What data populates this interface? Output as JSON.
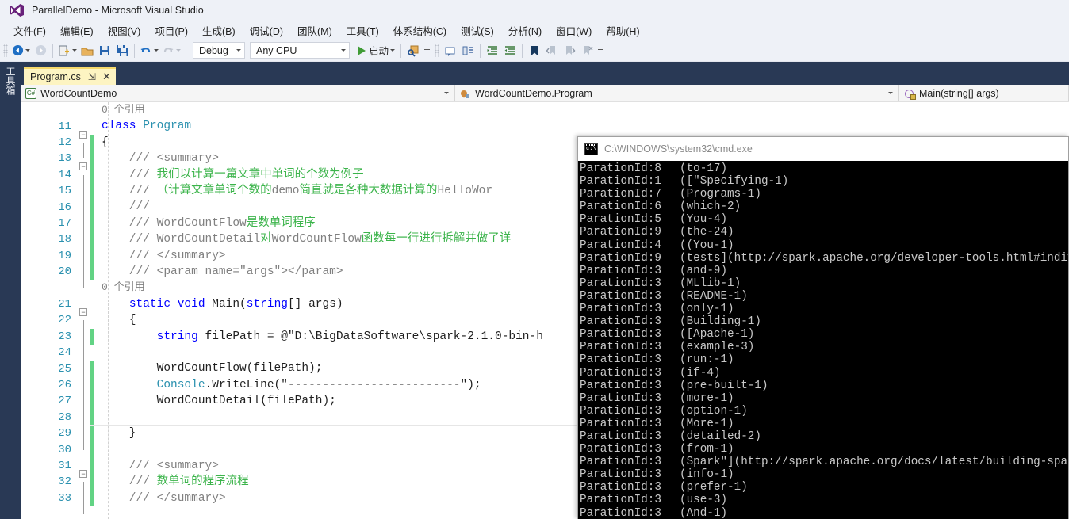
{
  "window": {
    "title": "ParallelDemo - Microsoft Visual Studio",
    "logo_icon": "visual-studio-logo"
  },
  "menubar": {
    "items": [
      {
        "label": "文件(F)"
      },
      {
        "label": "编辑(E)"
      },
      {
        "label": "视图(V)"
      },
      {
        "label": "项目(P)"
      },
      {
        "label": "生成(B)"
      },
      {
        "label": "调试(D)"
      },
      {
        "label": "团队(M)"
      },
      {
        "label": "工具(T)"
      },
      {
        "label": "体系结构(C)"
      },
      {
        "label": "测试(S)"
      },
      {
        "label": "分析(N)"
      },
      {
        "label": "窗口(W)"
      },
      {
        "label": "帮助(H)"
      }
    ]
  },
  "toolbar": {
    "back_icon": "navigate-back-icon",
    "forward_icon": "navigate-forward-icon",
    "new_item_icon": "new-item-icon",
    "open_icon": "open-file-icon",
    "save_icon": "save-icon",
    "save_all_icon": "save-all-icon",
    "undo_icon": "undo-icon",
    "redo_icon": "redo-icon",
    "configuration": "Debug",
    "platform": "Any CPU",
    "start_label": "启动",
    "start_icon": "play-icon",
    "find_icon": "find-in-files-icon",
    "comment_icon": "comment-selection-icon",
    "uncomment_icon": "uncomment-selection-icon",
    "indent_icon": "increase-indent-icon",
    "outdent_icon": "decrease-indent-icon",
    "bookmark_icon": "bookmark-icon",
    "prev_bookmark_icon": "previous-bookmark-icon",
    "next_bookmark_icon": "next-bookmark-icon",
    "clear_bookmark_icon": "clear-bookmarks-icon",
    "overflow_icon": "toolbar-overflow-icon"
  },
  "toolbox": {
    "label": "工具箱"
  },
  "tab": {
    "title": "Program.cs",
    "pin_icon": "pin-icon",
    "close_icon": "close-icon"
  },
  "navbar": {
    "project": "WordCountDemo",
    "project_icon": "csharp-project-icon",
    "type": "WordCountDemo.Program",
    "type_icon": "class-icon",
    "member": "Main(string[] args)",
    "member_icon": "method-icon"
  },
  "editor": {
    "ref_label_class": "0 个引用",
    "ref_label_main": "0 个引用",
    "lines": [
      {
        "num": "11",
        "text": "class Program",
        "change": "none",
        "fold": "minus"
      },
      {
        "num": "12",
        "text": "{",
        "change": "green",
        "fold": "none"
      },
      {
        "num": "13",
        "text": "    /// <summary>",
        "change": "green",
        "fold": "minus"
      },
      {
        "num": "14",
        "text": "    /// 我们以计算一篇文章中单词的个数为例子",
        "change": "green",
        "fold": "none"
      },
      {
        "num": "15",
        "text": "    /// （计算文章单词个数的demo简直就是各种大数据计算的HelloWor",
        "change": "green",
        "fold": "none"
      },
      {
        "num": "16",
        "text": "    ///",
        "change": "green",
        "fold": "none"
      },
      {
        "num": "17",
        "text": "    /// WordCountFlow是数单词程序",
        "change": "green",
        "fold": "none"
      },
      {
        "num": "18",
        "text": "    /// WordCountDetail对WordCountFlow函数每一行进行拆解并做了详",
        "change": "green",
        "fold": "none"
      },
      {
        "num": "19",
        "text": "    /// </summary>",
        "change": "green",
        "fold": "none"
      },
      {
        "num": "20",
        "text": "    /// <param name=\"args\"></param>",
        "change": "green",
        "fold": "none"
      },
      {
        "num": "21",
        "text": "    static void Main(string[] args)",
        "change": "none",
        "fold": "minus"
      },
      {
        "num": "22",
        "text": "    {",
        "change": "none",
        "fold": "none"
      },
      {
        "num": "23",
        "text": "        string filePath = @\"D:\\BigDataSoftware\\spark-2.1.0-bin-h",
        "change": "green",
        "fold": "none"
      },
      {
        "num": "24",
        "text": "",
        "change": "none",
        "fold": "none"
      },
      {
        "num": "25",
        "text": "        WordCountFlow(filePath);",
        "change": "green",
        "fold": "none"
      },
      {
        "num": "26",
        "text": "        Console.WriteLine(\"-------------------------\");",
        "change": "green",
        "fold": "none"
      },
      {
        "num": "27",
        "text": "        WordCountDetail(filePath);",
        "change": "green",
        "fold": "none"
      },
      {
        "num": "28",
        "text": "",
        "change": "green",
        "fold": "none"
      },
      {
        "num": "29",
        "text": "    }",
        "change": "green",
        "fold": "none"
      },
      {
        "num": "30",
        "text": "",
        "change": "green",
        "fold": "none"
      },
      {
        "num": "31",
        "text": "    /// <summary>",
        "change": "green",
        "fold": "minus"
      },
      {
        "num": "32",
        "text": "    /// 数单词的程序流程",
        "change": "green",
        "fold": "none"
      },
      {
        "num": "33",
        "text": "    /// </summary>",
        "change": "green",
        "fold": "none"
      }
    ]
  },
  "console": {
    "title": "C:\\WINDOWS\\system32\\cmd.exe",
    "icon": "cmd-icon",
    "rows": [
      {
        "pid": "ParationId:8",
        "value": "(to-17)"
      },
      {
        "pid": "ParationId:1",
        "value": "([\"Specifying-1)"
      },
      {
        "pid": "ParationId:7",
        "value": "(Programs-1)"
      },
      {
        "pid": "ParationId:6",
        "value": "(which-2)"
      },
      {
        "pid": "ParationId:5",
        "value": "(You-4)"
      },
      {
        "pid": "ParationId:9",
        "value": "(the-24)"
      },
      {
        "pid": "ParationId:4",
        "value": "((You-1)"
      },
      {
        "pid": "ParationId:9",
        "value": "(tests](http://spark.apache.org/developer-tools.html#individual"
      },
      {
        "pid": "ParationId:3",
        "value": "(and-9)"
      },
      {
        "pid": "ParationId:3",
        "value": "(MLlib-1)"
      },
      {
        "pid": "ParationId:3",
        "value": "(README-1)"
      },
      {
        "pid": "ParationId:3",
        "value": "(only-1)"
      },
      {
        "pid": "ParationId:3",
        "value": "(Building-1)"
      },
      {
        "pid": "ParationId:3",
        "value": "([Apache-1)"
      },
      {
        "pid": "ParationId:3",
        "value": "(example-3)"
      },
      {
        "pid": "ParationId:3",
        "value": "(run:-1)"
      },
      {
        "pid": "ParationId:3",
        "value": "(if-4)"
      },
      {
        "pid": "ParationId:3",
        "value": "(pre-built-1)"
      },
      {
        "pid": "ParationId:3",
        "value": "(more-1)"
      },
      {
        "pid": "ParationId:3",
        "value": "(option-1)"
      },
      {
        "pid": "ParationId:3",
        "value": "(More-1)"
      },
      {
        "pid": "ParationId:3",
        "value": "(detailed-2)"
      },
      {
        "pid": "ParationId:3",
        "value": "(from-1)"
      },
      {
        "pid": "ParationId:3",
        "value": "(Spark\"](http://spark.apache.org/docs/latest/building-spark.htm"
      },
      {
        "pid": "ParationId:3",
        "value": "(info-1)"
      },
      {
        "pid": "ParationId:3",
        "value": "(prefer-1)"
      },
      {
        "pid": "ParationId:3",
        "value": "(use-3)"
      },
      {
        "pid": "ParationId:3",
        "value": "(And-1)"
      }
    ]
  },
  "colors": {
    "chrome": "#eef1f7",
    "dark_band": "#293955",
    "tab_active": "#fdf4c2",
    "keyword": "#0000ff",
    "type": "#2b91af",
    "comment": "#808080",
    "comment_cn": "#3cb44b",
    "string": "#a31515",
    "change_marker": "#62d384",
    "console_bg": "#000000",
    "console_fg": "#c8c8c8"
  }
}
